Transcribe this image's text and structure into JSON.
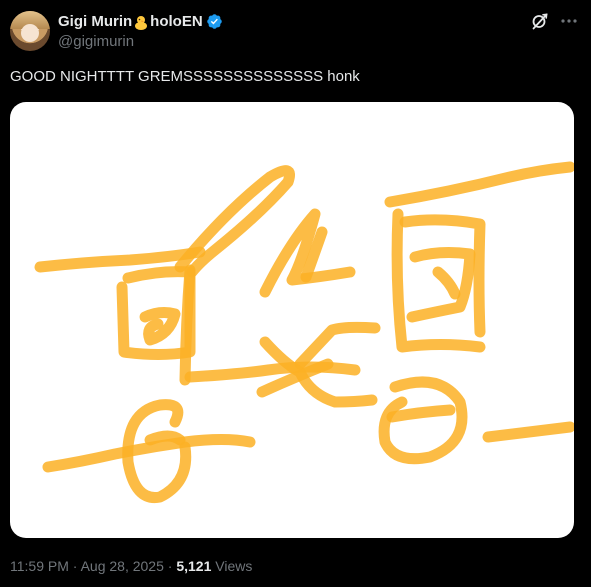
{
  "post": {
    "author": {
      "name": "Gigi Murin",
      "name_suffix": "holoEN",
      "name_emoji": "baby-chick-emoji",
      "handle": "@gigimurin",
      "verified": true,
      "verified_color": "#1d9bf0"
    },
    "text": "GOOD NIGHTTTT GREMSSSSSSSSSSSSSS honk",
    "timestamp": "11:59 PM",
    "date": "Aug 28, 2025",
    "separator": "·",
    "views_count": "5,121",
    "views_label": "Views"
  },
  "icons": {
    "grok": "grok-icon",
    "more": "more-icon"
  },
  "media": {
    "type": "drawing",
    "background": "#ffffff",
    "stroke_color": "#fbb024"
  },
  "colors": {
    "background": "#000000",
    "text_primary": "#e7e9ea",
    "text_secondary": "#71767b"
  }
}
